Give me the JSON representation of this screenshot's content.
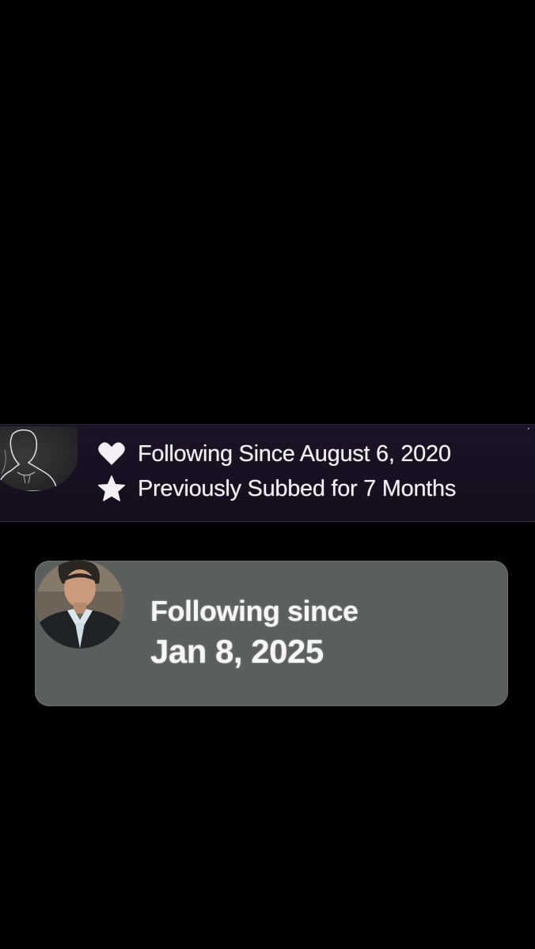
{
  "top_card": {
    "following_text": "Following Since August 6, 2020",
    "sub_text": "Previously Subbed for 7 Months",
    "icons": {
      "following": "heart-icon",
      "sub": "star-icon"
    },
    "colors": {
      "background": "#1b1326",
      "text": "#f4f2f6"
    }
  },
  "bottom_card": {
    "label": "Following since",
    "date": "Jan 8, 2025",
    "colors": {
      "background": "#5a5f5e",
      "text": "#f6f6f4"
    }
  }
}
